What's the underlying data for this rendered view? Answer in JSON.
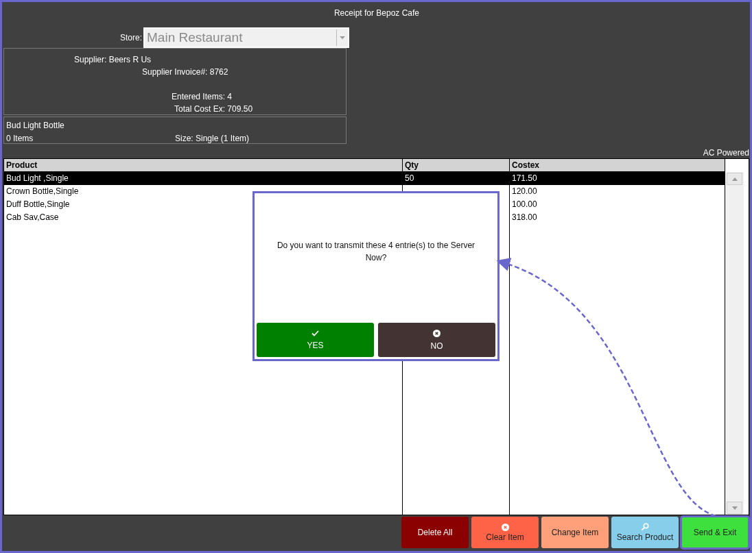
{
  "window": {
    "title": "Receipt for Bepoz Cafe"
  },
  "store": {
    "label": "Store:",
    "value": "Main Restaurant"
  },
  "summary": {
    "supplier": "Supplier: Beers R Us",
    "invoice": "Supplier Invoice#: 8762",
    "entered": "Entered Items: 4",
    "total": "Total Cost Ex: 709.50"
  },
  "product": {
    "name": "Bud Light Bottle",
    "items": "0 Items",
    "size": "Size: Single (1 Item)"
  },
  "status": "AC Powered",
  "table": {
    "columns": [
      "Product",
      "Qty",
      "Costex"
    ],
    "rows": [
      {
        "product": "Bud Light ,Single",
        "qty": "50",
        "costex": "171.50",
        "selected": true
      },
      {
        "product": "Crown Bottle,Single",
        "costex": "120.00",
        "selected": false
      },
      {
        "product": "Duff Bottle,Single",
        "costex": "100.00",
        "selected": false
      },
      {
        "product": "Cab Sav,Case",
        "costex": "318.00",
        "selected": false
      }
    ]
  },
  "dialog": {
    "message": "Do you want to transmit these 4 entrie(s) to the Server Now?",
    "buttons": [
      {
        "label": "YES",
        "kind": "yes"
      },
      {
        "label": "NO",
        "kind": "no"
      }
    ]
  },
  "buttons": [
    {
      "label": "Delete All",
      "kind": "delete",
      "highlighted": false
    },
    {
      "label": "Clear Item",
      "kind": "clear",
      "highlighted": false
    },
    {
      "label": "Change Item",
      "kind": "change",
      "highlighted": false
    },
    {
      "label": "Search Product",
      "kind": "search",
      "highlighted": false
    },
    {
      "label": "Send & Exit",
      "kind": "send",
      "highlighted": true
    }
  ]
}
